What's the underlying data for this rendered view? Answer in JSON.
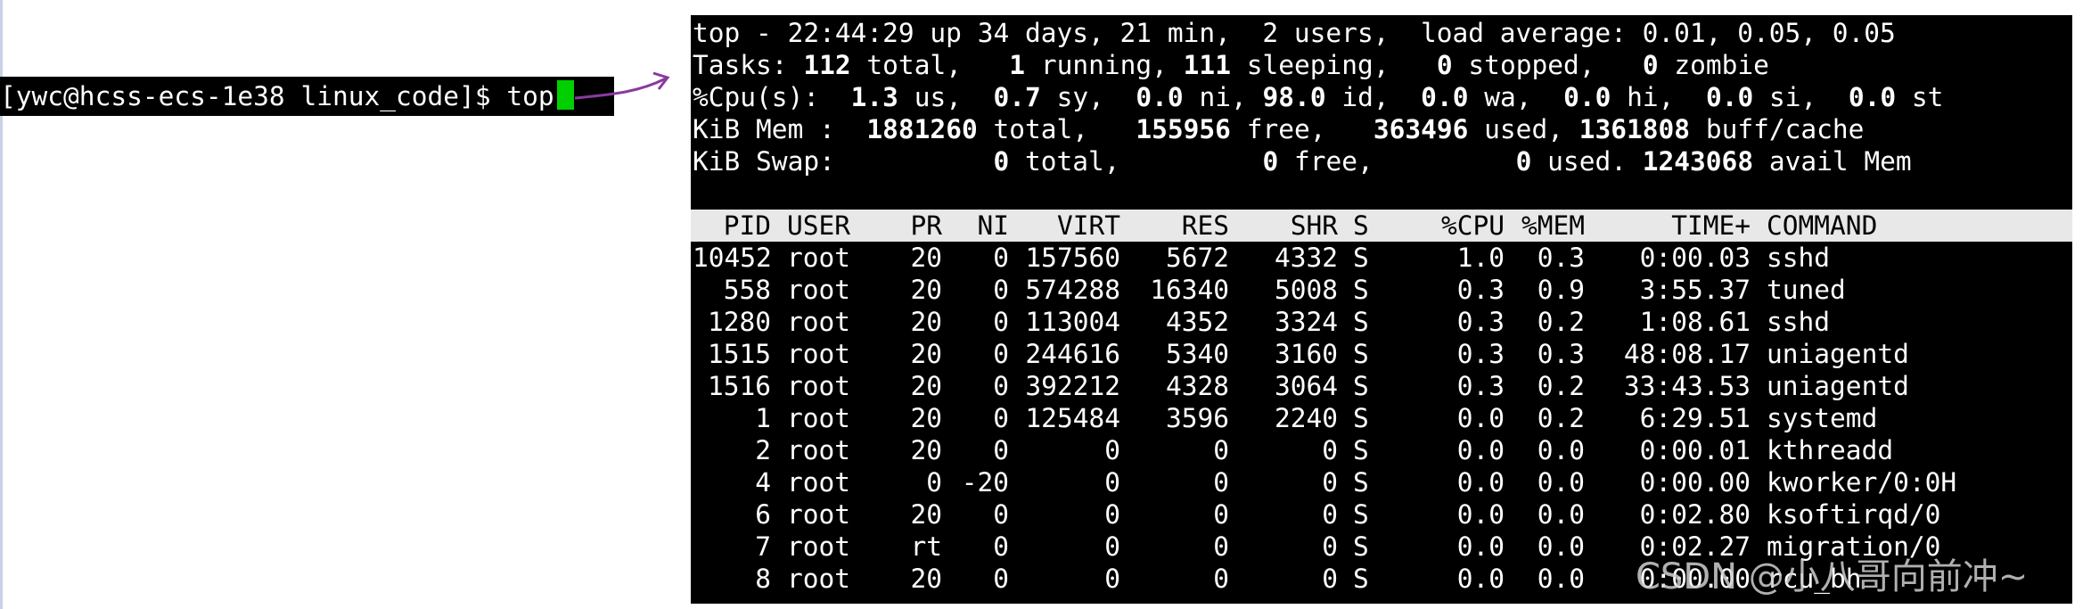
{
  "prompt": {
    "text": "[ywc@hcss-ecs-1e38 linux_code]$ top"
  },
  "summary": {
    "line1": "top - 22:44:29 up 34 days, 21 min,  2 users,  load average: 0.01, 0.05, 0.05",
    "tasks": {
      "label": "Tasks:",
      "total": "112",
      "total_label": "total,",
      "running": "1",
      "running_label": "running,",
      "sleeping": "111",
      "sleeping_label": "sleeping,",
      "stopped": "0",
      "stopped_label": "stopped,",
      "zombie": "0",
      "zombie_label": "zombie"
    },
    "cpu": {
      "label": "%Cpu(s):",
      "us": "1.3",
      "us_label": "us,",
      "sy": "0.7",
      "sy_label": "sy,",
      "ni": "0.0",
      "ni_label": "ni,",
      "id": "98.0",
      "id_label": "id,",
      "wa": "0.0",
      "wa_label": "wa,",
      "hi": "0.0",
      "hi_label": "hi,",
      "si": "0.0",
      "si_label": "si,",
      "st": "0.0",
      "st_label": "st"
    },
    "mem": {
      "label": "KiB Mem :",
      "total": "1881260",
      "total_label": "total,",
      "free": "155956",
      "free_label": "free,",
      "used": "363496",
      "used_label": "used,",
      "buff": "1361808",
      "buff_label": "buff/cache"
    },
    "swap": {
      "label": "KiB Swap:",
      "total": "0",
      "total_label": "total,",
      "free": "0",
      "free_label": "free,",
      "used": "0",
      "used_label": "used.",
      "avail": "1243068",
      "avail_label": "avail Mem"
    }
  },
  "headers": [
    "PID",
    "USER",
    "PR",
    "NI",
    "VIRT",
    "RES",
    "SHR",
    "S",
    "%CPU",
    "%MEM",
    "TIME+",
    "COMMAND"
  ],
  "processes": [
    [
      "10452",
      "root",
      "20",
      "0",
      "157560",
      "5672",
      "4332",
      "S",
      "1.0",
      "0.3",
      "0:00.03",
      "sshd"
    ],
    [
      "558",
      "root",
      "20",
      "0",
      "574288",
      "16340",
      "5008",
      "S",
      "0.3",
      "0.9",
      "3:55.37",
      "tuned"
    ],
    [
      "1280",
      "root",
      "20",
      "0",
      "113004",
      "4352",
      "3324",
      "S",
      "0.3",
      "0.2",
      "1:08.61",
      "sshd"
    ],
    [
      "1515",
      "root",
      "20",
      "0",
      "244616",
      "5340",
      "3160",
      "S",
      "0.3",
      "0.3",
      "48:08.17",
      "uniagentd"
    ],
    [
      "1516",
      "root",
      "20",
      "0",
      "392212",
      "4328",
      "3064",
      "S",
      "0.3",
      "0.2",
      "33:43.53",
      "uniagentd"
    ],
    [
      "1",
      "root",
      "20",
      "0",
      "125484",
      "3596",
      "2240",
      "S",
      "0.0",
      "0.2",
      "6:29.51",
      "systemd"
    ],
    [
      "2",
      "root",
      "20",
      "0",
      "0",
      "0",
      "0",
      "S",
      "0.0",
      "0.0",
      "0:00.01",
      "kthreadd"
    ],
    [
      "4",
      "root",
      "0",
      "-20",
      "0",
      "0",
      "0",
      "S",
      "0.0",
      "0.0",
      "0:00.00",
      "kworker/0:0H"
    ],
    [
      "6",
      "root",
      "20",
      "0",
      "0",
      "0",
      "0",
      "S",
      "0.0",
      "0.0",
      "0:02.80",
      "ksoftirqd/0"
    ],
    [
      "7",
      "root",
      "rt",
      "0",
      "0",
      "0",
      "0",
      "S",
      "0.0",
      "0.0",
      "0:02.27",
      "migration/0"
    ],
    [
      "8",
      "root",
      "20",
      "0",
      "0",
      "0",
      "0",
      "S",
      "0.0",
      "0.0",
      "0:00.00",
      "rcu_bh"
    ]
  ],
  "watermark": "CSDN @小八哥向前冲~"
}
